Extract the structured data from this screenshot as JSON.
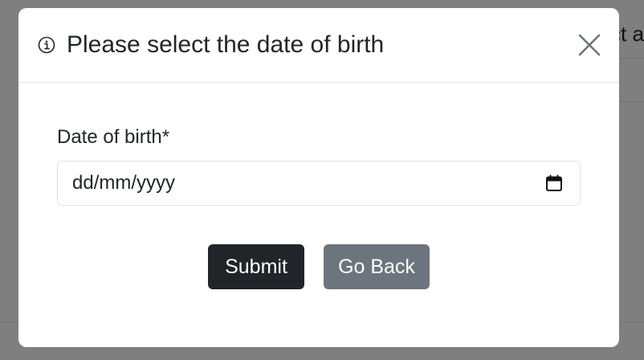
{
  "background": {
    "partial_text": "ct a"
  },
  "modal": {
    "title": "Please select the date of birth",
    "title_icon": "info-circle-icon",
    "close_icon": "close-icon",
    "field": {
      "label": "Date of birth*",
      "placeholder": "dd/mm/yyyy",
      "icon": "calendar-icon"
    },
    "buttons": {
      "submit": "Submit",
      "back": "Go Back"
    }
  },
  "colors": {
    "submit_bg": "#212529",
    "back_bg": "#6c757d",
    "text": "#212529",
    "border": "#dee2e6"
  }
}
